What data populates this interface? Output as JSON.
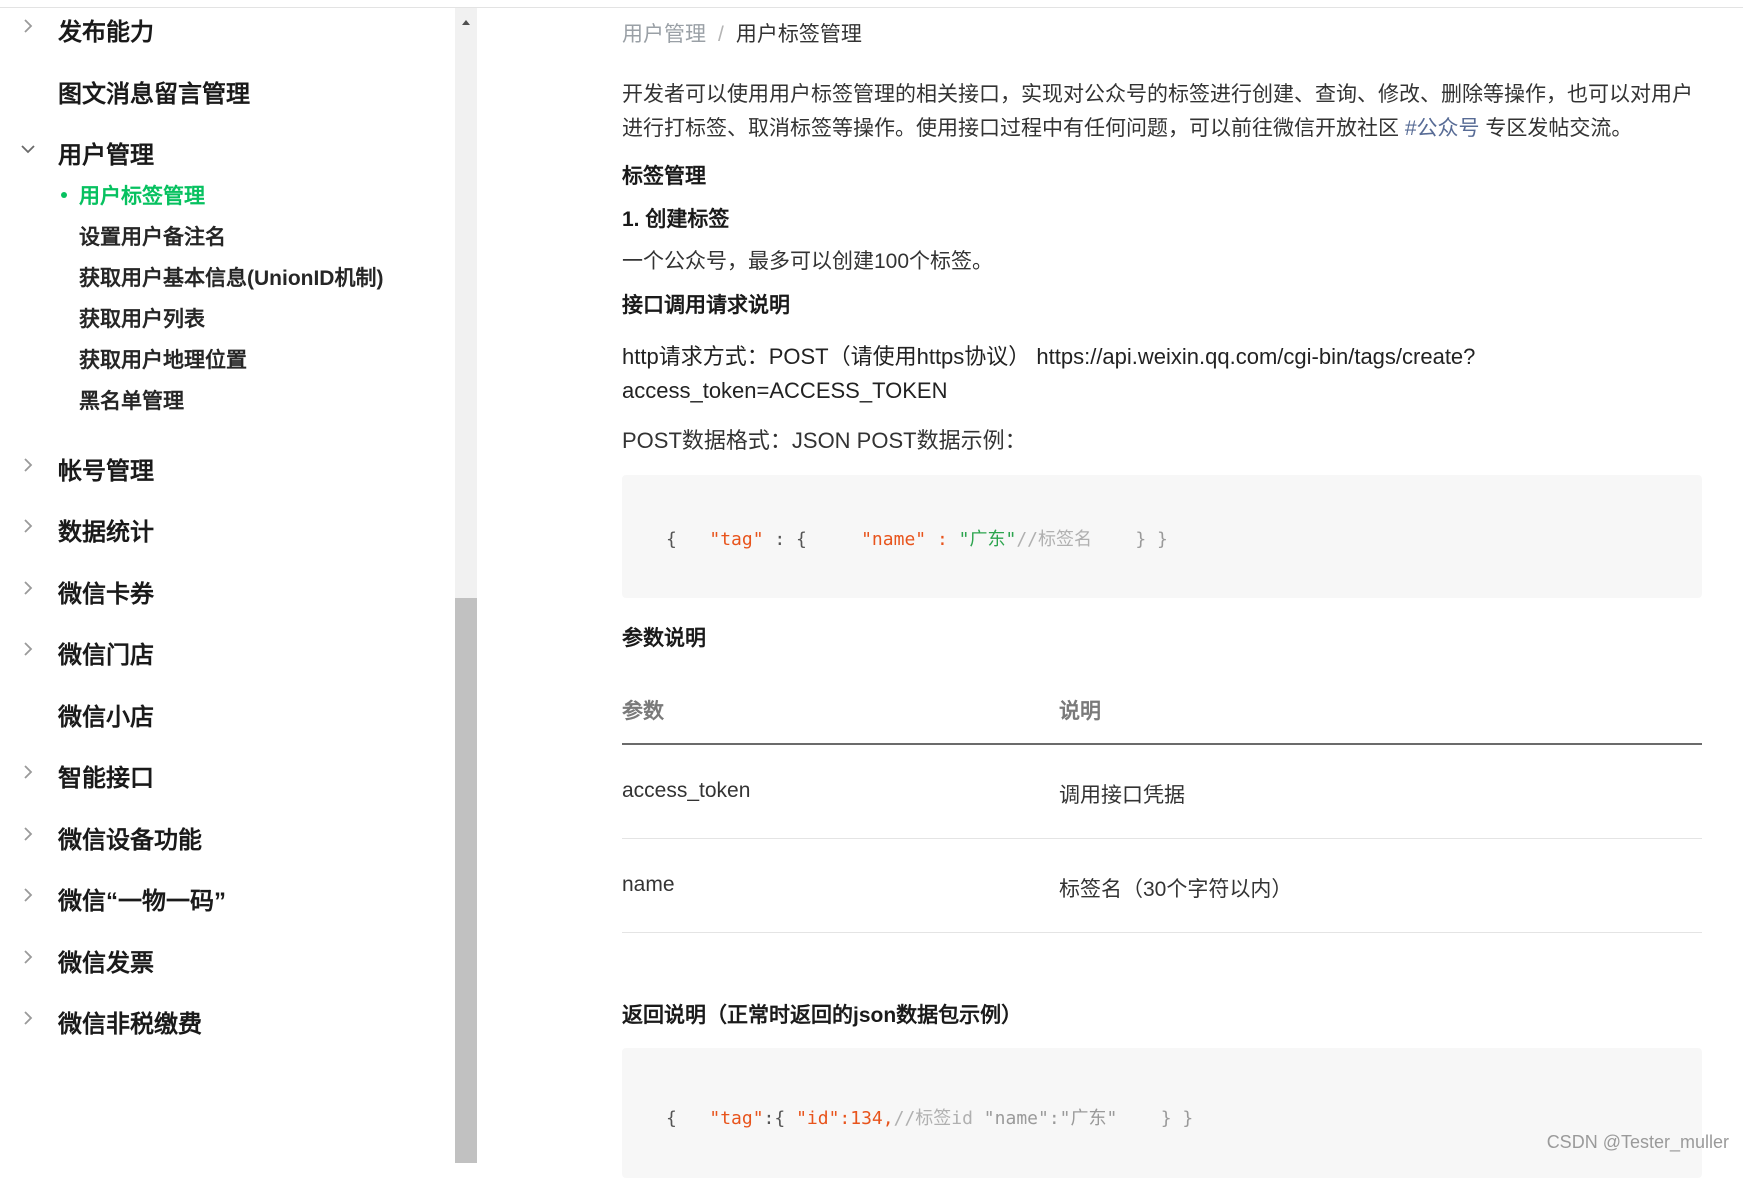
{
  "sidebar": {
    "top_items": [
      {
        "label": "发布能力",
        "icon": "chevron-right-icon"
      },
      {
        "label": "图文消息留言管理",
        "icon": ""
      }
    ],
    "user_management": {
      "label": "用户管理",
      "icon": "chevron-down-icon",
      "children": [
        {
          "label": "用户标签管理",
          "active": true
        },
        {
          "label": "设置用户备注名"
        },
        {
          "label": "获取用户基本信息(UnionID机制)"
        },
        {
          "label": "获取用户列表"
        },
        {
          "label": "获取用户地理位置"
        },
        {
          "label": "黑名单管理"
        }
      ]
    },
    "bottom_items": [
      {
        "label": "帐号管理",
        "icon": "chevron-right-icon"
      },
      {
        "label": "数据统计",
        "icon": "chevron-right-icon"
      },
      {
        "label": "微信卡券",
        "icon": "chevron-right-icon"
      },
      {
        "label": "微信门店",
        "icon": "chevron-right-icon"
      },
      {
        "label": "微信小店",
        "icon": ""
      },
      {
        "label": "智能接口",
        "icon": "chevron-right-icon"
      },
      {
        "label": "微信设备功能",
        "icon": "chevron-right-icon"
      },
      {
        "label": "微信“一物一码”",
        "icon": "chevron-right-icon"
      },
      {
        "label": "微信发票",
        "icon": "chevron-right-icon"
      },
      {
        "label": "微信非税缴费",
        "icon": "chevron-right-icon"
      }
    ]
  },
  "breadcrumb": {
    "parent": "用户管理",
    "separator": "/",
    "current": "用户标签管理"
  },
  "intro": {
    "text_before_link": "开发者可以使用用户标签管理的相关接口，实现对公众号的标签进行创建、查询、修改、删除等操作，也可以对用户进行打标签、取消标签等操作。使用接口过程中有任何问题，可以前往微信开放社区 ",
    "link": "#公众号",
    "text_after_link": " 专区发帖交流。"
  },
  "sections": {
    "tag_mgmt": "标签管理",
    "create_tag": "1. 创建标签",
    "limit_note": "一个公众号，最多可以创建100个标签。",
    "api_desc": "接口调用请求说明",
    "http_line1": "http请求方式：POST（请使用https协议） https://api.weixin.qq.com/cgi-bin/tags/create?",
    "http_line2": "access_token=ACCESS_TOKEN",
    "post_format": "POST数据格式：JSON POST数据示例：",
    "params_title": "参数说明",
    "return_title": "返回说明（正常时返回的json数据包示例）"
  },
  "code1": {
    "brace_open": "{",
    "key_tag": "\"tag\"",
    "colon_brace": " : {",
    "key_name": "\"name\"",
    "colon": " : ",
    "val_name": "\"广东\"",
    "comment": "//标签名",
    "close": "} }"
  },
  "code2": {
    "brace_open": "{",
    "key_tag": "\"tag\"",
    "colon_brace": ":{ ",
    "key_id": "\"id\"",
    "id_val": ":134,",
    "comment": "//标签id",
    "rest": " \"name\":\"广东\"",
    "close": "} }"
  },
  "params_table": {
    "headers": [
      "参数",
      "说明"
    ],
    "rows": [
      [
        "access_token",
        "调用接口凭据"
      ],
      [
        "name",
        "标签名（30个字符以内）"
      ]
    ]
  },
  "watermark": "CSDN @Tester_muller",
  "colors": {
    "active_green": "#07c160",
    "link_blue": "#576b95",
    "code_key": "#e8541c",
    "code_string": "#2ca44e"
  }
}
